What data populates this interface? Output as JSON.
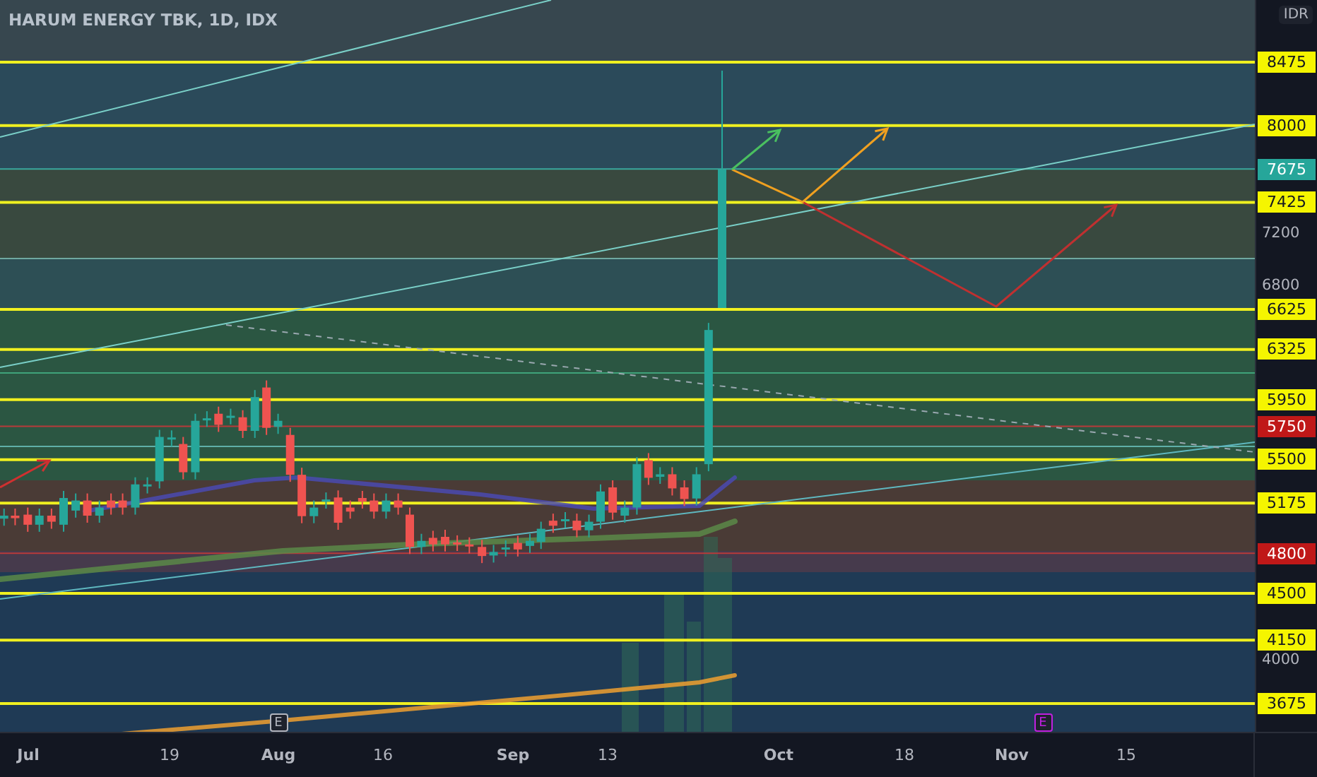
{
  "chart": {
    "title": "HARUM ENERGY TBK, 1D, IDX",
    "currency": "IDR",
    "price_labels": [
      {
        "text": "8475",
        "kind": "level"
      },
      {
        "text": "8000",
        "kind": "level"
      },
      {
        "text": "7675",
        "kind": "last"
      },
      {
        "text": "7425",
        "kind": "level"
      },
      {
        "text": "6625",
        "kind": "level"
      },
      {
        "text": "6325",
        "kind": "level"
      },
      {
        "text": "5950",
        "kind": "level"
      },
      {
        "text": "5750",
        "kind": "alert"
      },
      {
        "text": "5500",
        "kind": "level"
      },
      {
        "text": "5175",
        "kind": "level"
      },
      {
        "text": "4800",
        "kind": "alert"
      },
      {
        "text": "4500",
        "kind": "level"
      },
      {
        "text": "4150",
        "kind": "level"
      },
      {
        "text": "3675",
        "kind": "level"
      }
    ],
    "price_ticks": [
      "7200",
      "6800",
      "4000"
    ],
    "time_labels": [
      "Jul",
      "19",
      "Aug",
      "16",
      "Sep",
      "13",
      "Oct",
      "18",
      "Nov",
      "15"
    ],
    "events": [
      {
        "label": "E",
        "color": "#b2b5be"
      },
      {
        "label": "E",
        "color": "#c020e0"
      }
    ]
  }
}
